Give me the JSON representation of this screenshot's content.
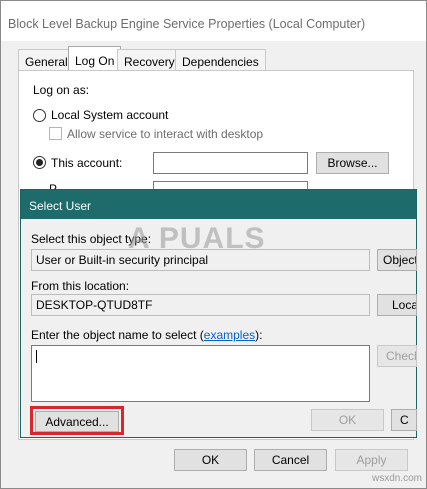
{
  "outer": {
    "title": "Block Level Backup Engine Service Properties (Local Computer)",
    "tabs": [
      {
        "label": "General",
        "active": false
      },
      {
        "label": "Log On",
        "active": true
      },
      {
        "label": "Recovery",
        "active": false
      },
      {
        "label": "Dependencies",
        "active": false
      }
    ],
    "logon_as": "Log on as:",
    "local_system": "Local System account",
    "allow_interact": "Allow service to interact with desktop",
    "this_account": "This account:",
    "browse": "Browse...",
    "password_partial": "P",
    "footer": {
      "ok": "OK",
      "cancel": "Cancel",
      "apply": "Apply"
    }
  },
  "select_user": {
    "title": "Select User",
    "object_type_label": "Select this object type:",
    "object_type_value": "User or Built-in security principal",
    "object_types_button": "Object",
    "location_label": "From this location:",
    "location_value": "DESKTOP-QTUD8TF",
    "locations_button": "Loca",
    "enter_name_prefix": "Enter the object name to select (",
    "examples_link": "examples",
    "enter_name_suffix": "):",
    "check_names_button": "Check",
    "advanced_button": "Advanced...",
    "ok_button": "OK",
    "cancel_button": "C"
  },
  "watermark": {
    "logo": "A  PUALS",
    "site": "wsxdn.com"
  }
}
